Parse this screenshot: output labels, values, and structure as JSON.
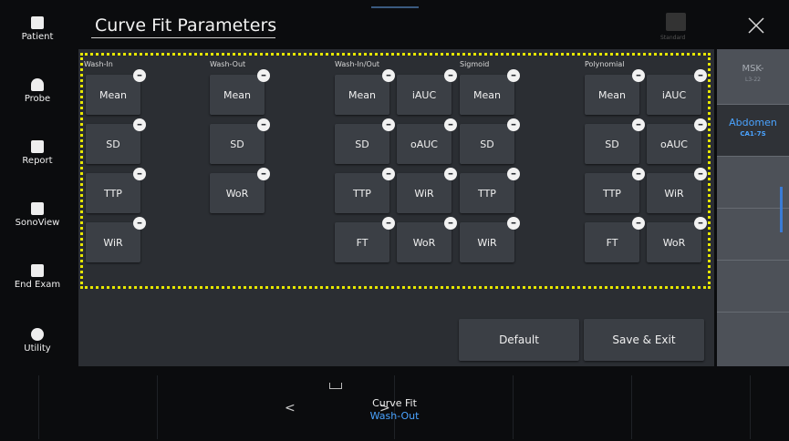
{
  "header": {
    "title": "Curve Fit Parameters",
    "standard_label": "Standard"
  },
  "sidebar": {
    "items": [
      {
        "label": "Patient",
        "icon": "patient-icon"
      },
      {
        "label": "Probe",
        "icon": "probe-icon"
      },
      {
        "label": "Report",
        "icon": "report-icon"
      },
      {
        "label": "SonoView",
        "icon": "sonoview-icon"
      },
      {
        "label": "End Exam",
        "icon": "end-exam-icon"
      },
      {
        "label": "Utility",
        "icon": "utility-icon"
      }
    ]
  },
  "groups": {
    "wash_in": {
      "label": "Wash-In",
      "buttons": [
        "Mean",
        "SD",
        "TTP",
        "WiR"
      ]
    },
    "wash_out": {
      "label": "Wash-Out",
      "buttons": [
        "Mean",
        "SD",
        "WoR"
      ]
    },
    "wash_in_out": {
      "label": "Wash-In/Out",
      "col1": [
        "Mean",
        "SD",
        "TTP",
        "FT"
      ],
      "col2": [
        "iAUC",
        "oAUC",
        "WiR",
        "WoR"
      ]
    },
    "sigmoid": {
      "label": "Sigmoid",
      "buttons": [
        "Mean",
        "SD",
        "TTP",
        "WiR"
      ]
    },
    "polynomial": {
      "label": "Polynomial",
      "col1": [
        "Mean",
        "SD",
        "TTP",
        "FT"
      ],
      "col2": [
        "iAUC",
        "oAUC",
        "WiR",
        "WoR"
      ]
    }
  },
  "actions": {
    "default_label": "Default",
    "save_label": "Save & Exit"
  },
  "probes": [
    {
      "name": "MSK-",
      "sub": "L3-22",
      "active": false
    },
    {
      "name": "Abdomen",
      "sub": "CA1-7S",
      "active": true
    }
  ],
  "bottom": {
    "title": "Curve Fit",
    "value": "Wash-Out"
  },
  "colors": {
    "accent": "#4aa3ff",
    "selection": "#e6e600",
    "panel": "#2b2e33"
  }
}
